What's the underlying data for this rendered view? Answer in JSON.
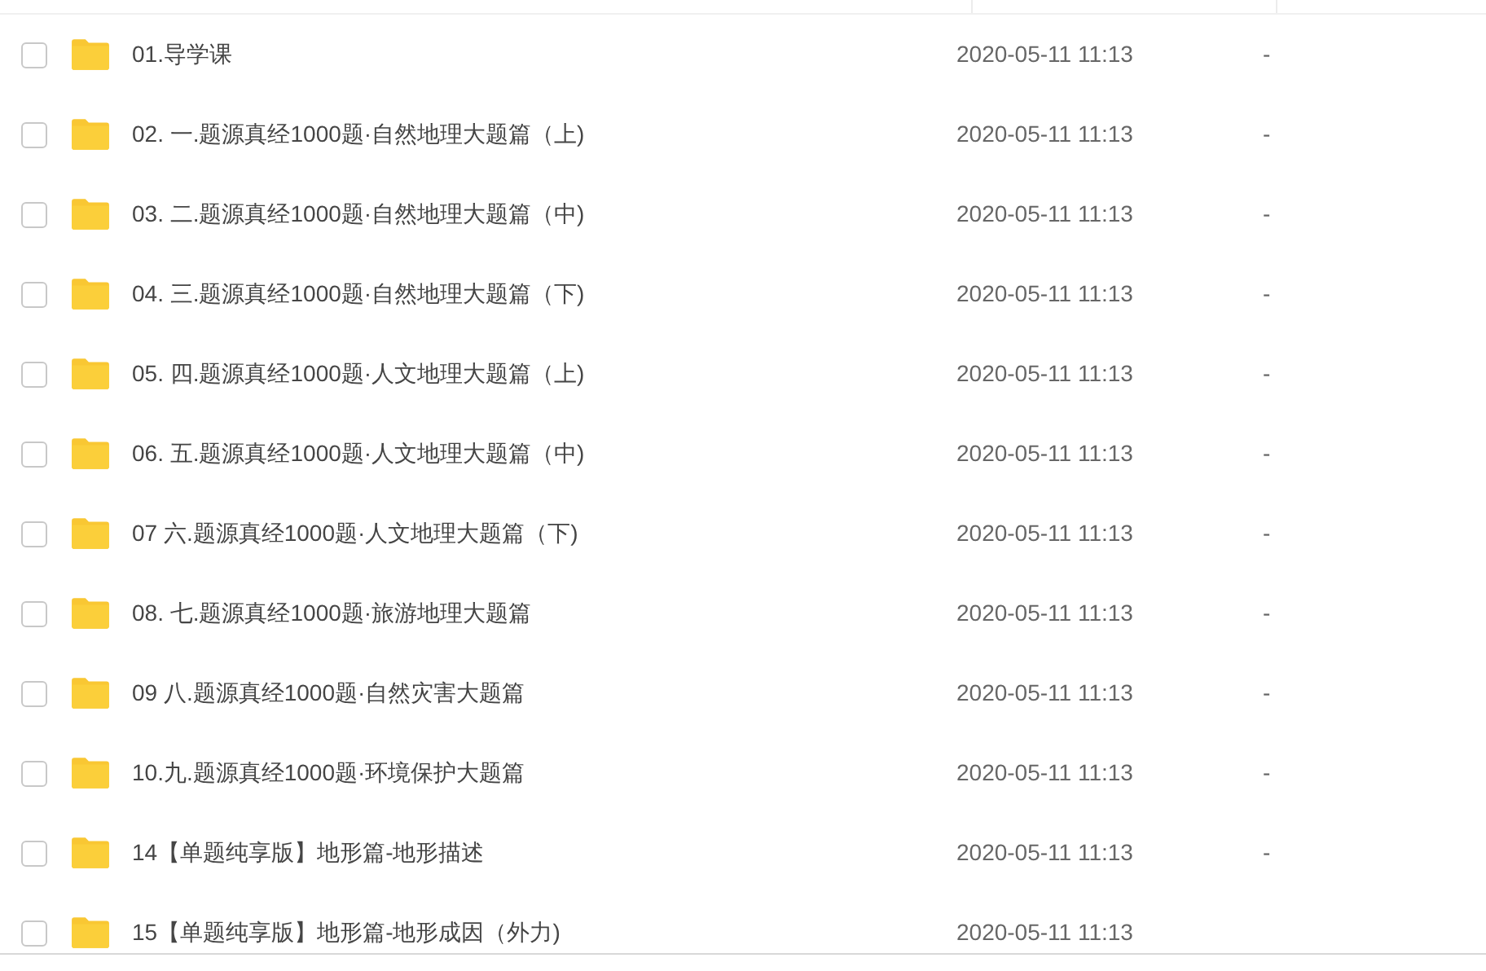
{
  "files": [
    {
      "name": "01.导学课",
      "modified": "2020-05-11 11:13",
      "size": "-",
      "checked": false
    },
    {
      "name": "02. 一.题源真经1000题·自然地理大题篇（上)",
      "modified": "2020-05-11 11:13",
      "size": "-",
      "checked": false
    },
    {
      "name": "03. 二.题源真经1000题·自然地理大题篇（中)",
      "modified": "2020-05-11 11:13",
      "size": "-",
      "checked": false
    },
    {
      "name": "04. 三.题源真经1000题·自然地理大题篇（下)",
      "modified": "2020-05-11 11:13",
      "size": "-",
      "checked": false
    },
    {
      "name": "05. 四.题源真经1000题·人文地理大题篇（上)",
      "modified": "2020-05-11 11:13",
      "size": "-",
      "checked": false
    },
    {
      "name": "06. 五.题源真经1000题·人文地理大题篇（中)",
      "modified": "2020-05-11 11:13",
      "size": "-",
      "checked": false
    },
    {
      "name": "07 六.题源真经1000题·人文地理大题篇（下)",
      "modified": "2020-05-11 11:13",
      "size": "-",
      "checked": false
    },
    {
      "name": "08. 七.题源真经1000题·旅游地理大题篇",
      "modified": "2020-05-11 11:13",
      "size": "-",
      "checked": false
    },
    {
      "name": "09 八.题源真经1000题·自然灾害大题篇",
      "modified": "2020-05-11 11:13",
      "size": "-",
      "checked": false
    },
    {
      "name": "10.九.题源真经1000题·环境保护大题篇",
      "modified": "2020-05-11 11:13",
      "size": "-",
      "checked": false
    },
    {
      "name": "14【单题纯享版】地形篇-地形描述",
      "modified": "2020-05-11 11:13",
      "size": "-",
      "checked": false
    },
    {
      "name": "15【单题纯享版】地形篇-地形成因（外力)",
      "modified": "2020-05-11 11:13",
      "checked": false
    }
  ]
}
